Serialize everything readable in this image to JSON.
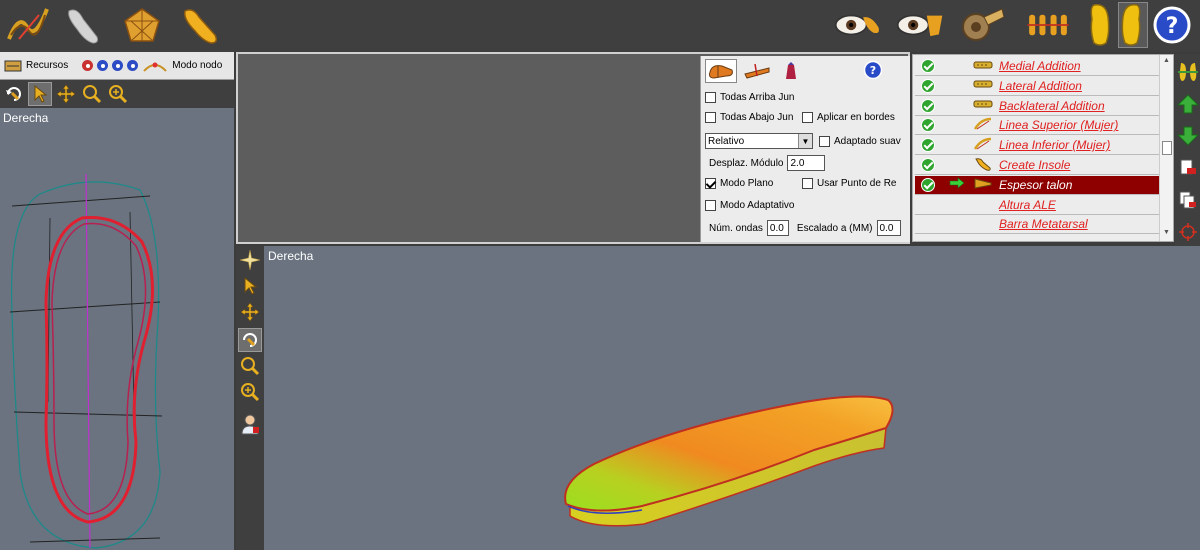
{
  "window": {
    "accent": "#8e0000"
  },
  "left_panel": {
    "toolbar_label": "Recursos",
    "mode_label": "Modo nodo",
    "view_title": "Derecha"
  },
  "properties": {
    "todas_arriba": "Todas Arriba Jun",
    "todas_abajo": "Todas Abajo Jun",
    "aplicar_bordes": "Aplicar en bordes",
    "mode_select": "Relativo",
    "adaptado": "Adaptado suav",
    "desplaz_label": "Desplaz. Módulo",
    "desplaz_value": "2.0",
    "modo_plano": "Modo Plano",
    "usar_punto": "Usar Punto de Re",
    "modo_adaptativo": "Modo Adaptativo",
    "num_ondas_label": "Núm. ondas",
    "num_ondas_value": "0.0",
    "escalado_label": "Escalado a (MM)",
    "escalado_value": "0.0",
    "help_icon": "help-icon"
  },
  "operations": [
    {
      "label": "Medial Addition",
      "checked": true,
      "selected": false
    },
    {
      "label": "Lateral Addition",
      "checked": true,
      "selected": false
    },
    {
      "label": "Backlateral Addition",
      "checked": true,
      "selected": false
    },
    {
      "label": "Linea Superior (Mujer)",
      "checked": true,
      "selected": false
    },
    {
      "label": "Linea Inferior (Mujer)",
      "checked": true,
      "selected": false
    },
    {
      "label": "Create Insole",
      "checked": true,
      "selected": false
    },
    {
      "label": "Espesor talon",
      "checked": true,
      "selected": true
    },
    {
      "label": "Altura ALE",
      "checked": false,
      "selected": false
    },
    {
      "label": "Barra Metatarsal",
      "checked": false,
      "selected": false
    }
  ],
  "view3d": {
    "title": "Derecha"
  }
}
